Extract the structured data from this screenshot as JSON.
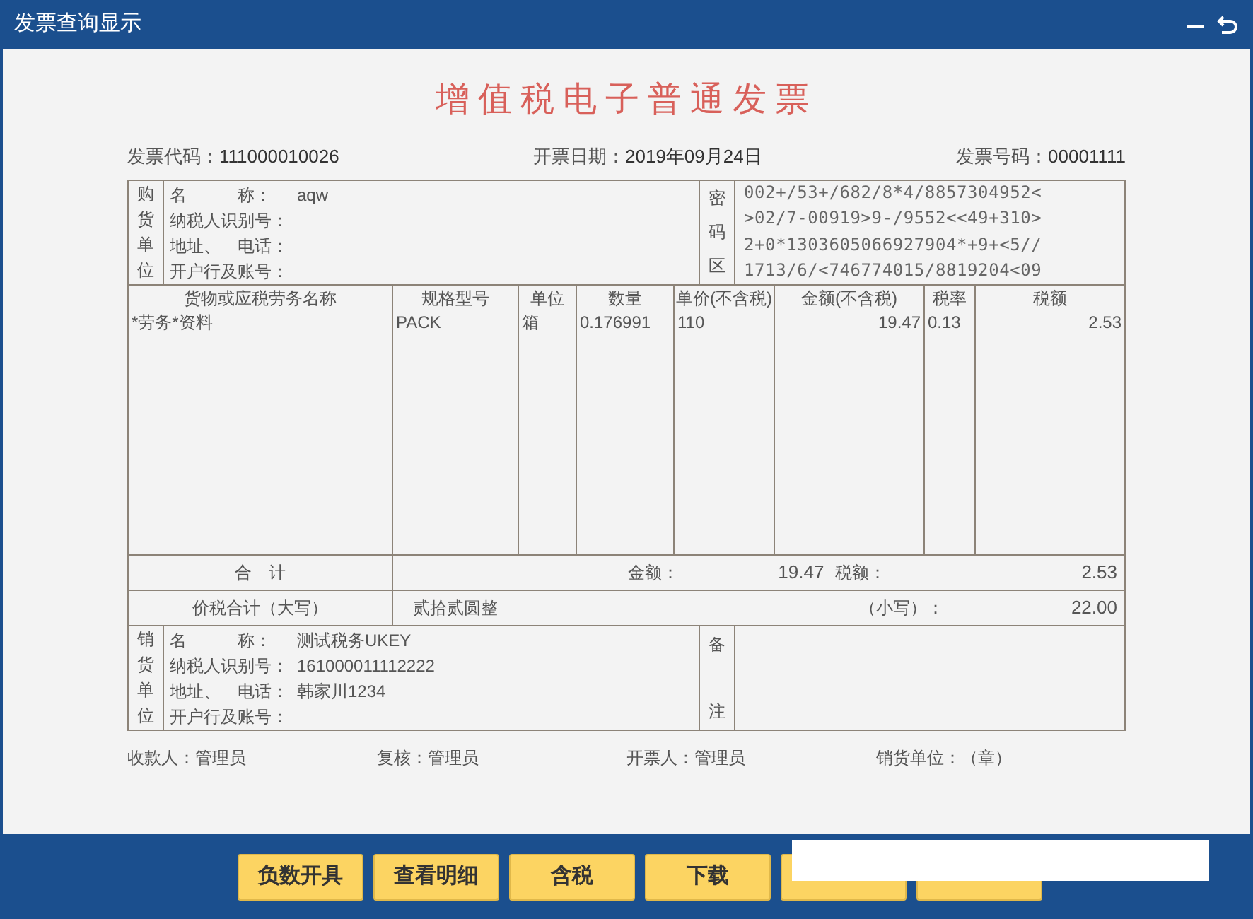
{
  "window": {
    "title": "发票查询显示"
  },
  "invoice": {
    "title": "增值税电子普通发票",
    "meta": [
      {
        "label": "发票代码：",
        "value": "111000010026"
      },
      {
        "label": "开票日期：",
        "value": "2019年09月24日"
      },
      {
        "label": "发票号码：",
        "value": "00001111"
      }
    ],
    "buyer": {
      "side_label": [
        "购",
        "货",
        "单",
        "位"
      ],
      "fields": [
        {
          "label": "名　　　称：",
          "value": "aqw"
        },
        {
          "label": "纳税人识别号："
        },
        {
          "label": "地址、　电话："
        },
        {
          "label": "开户行及账号："
        }
      ]
    },
    "cipher": {
      "side_label": [
        "密",
        "码",
        "区"
      ],
      "lines": [
        "002+/53+/682/8*4/8857304952<",
        ">02/7-00919>9-/9552<<49+310>",
        "2+0*1303605066927904*+9+<5//",
        "1713/6/<746774015/8819204<09"
      ]
    },
    "columns": [
      "货物或应税劳务名称",
      "规格型号",
      "单位",
      "数量",
      "单价(不含税)",
      "金额(不含税)",
      "税率",
      "税额"
    ],
    "rows": [
      [
        "*劳务*资料",
        "PACK",
        "箱",
        "0.176991",
        "110",
        "19.47",
        "0.13",
        "2.53"
      ]
    ],
    "total": {
      "label": "合　计",
      "amount_label": "金额：",
      "amount": "19.47",
      "tax_label": "税额：",
      "tax": "2.53"
    },
    "grand_total": {
      "label": "价税合计（大写）",
      "words": "贰拾贰圆整",
      "small_label": "（小写）：",
      "value": "22.00"
    },
    "seller": {
      "side_label": [
        "销",
        "货",
        "单",
        "位"
      ],
      "fields": [
        {
          "label": "名　　　称：",
          "value": "测试税务UKEY"
        },
        {
          "label": "纳税人识别号：",
          "value": "161000011112222"
        },
        {
          "label": "地址、　电话：",
          "value": "韩家川1234"
        },
        {
          "label": "开户行及账号："
        }
      ]
    },
    "remarks": {
      "side_label": [
        "备",
        "注"
      ]
    },
    "signatures": [
      {
        "label": "收款人：",
        "value": "管理员"
      },
      {
        "label": "复核：",
        "value": "管理员"
      },
      {
        "label": "开票人：",
        "value": "管理员"
      },
      {
        "label": "销货单位：",
        "value": "（章）"
      }
    ]
  },
  "buttons": [
    {
      "kind": "label",
      "label": "负数开具"
    },
    {
      "kind": "label",
      "label": "查看明细"
    },
    {
      "kind": "label",
      "label": "含税"
    },
    {
      "kind": "label",
      "label": "下载"
    },
    {
      "kind": "covered"
    },
    {
      "kind": "covered"
    }
  ]
}
